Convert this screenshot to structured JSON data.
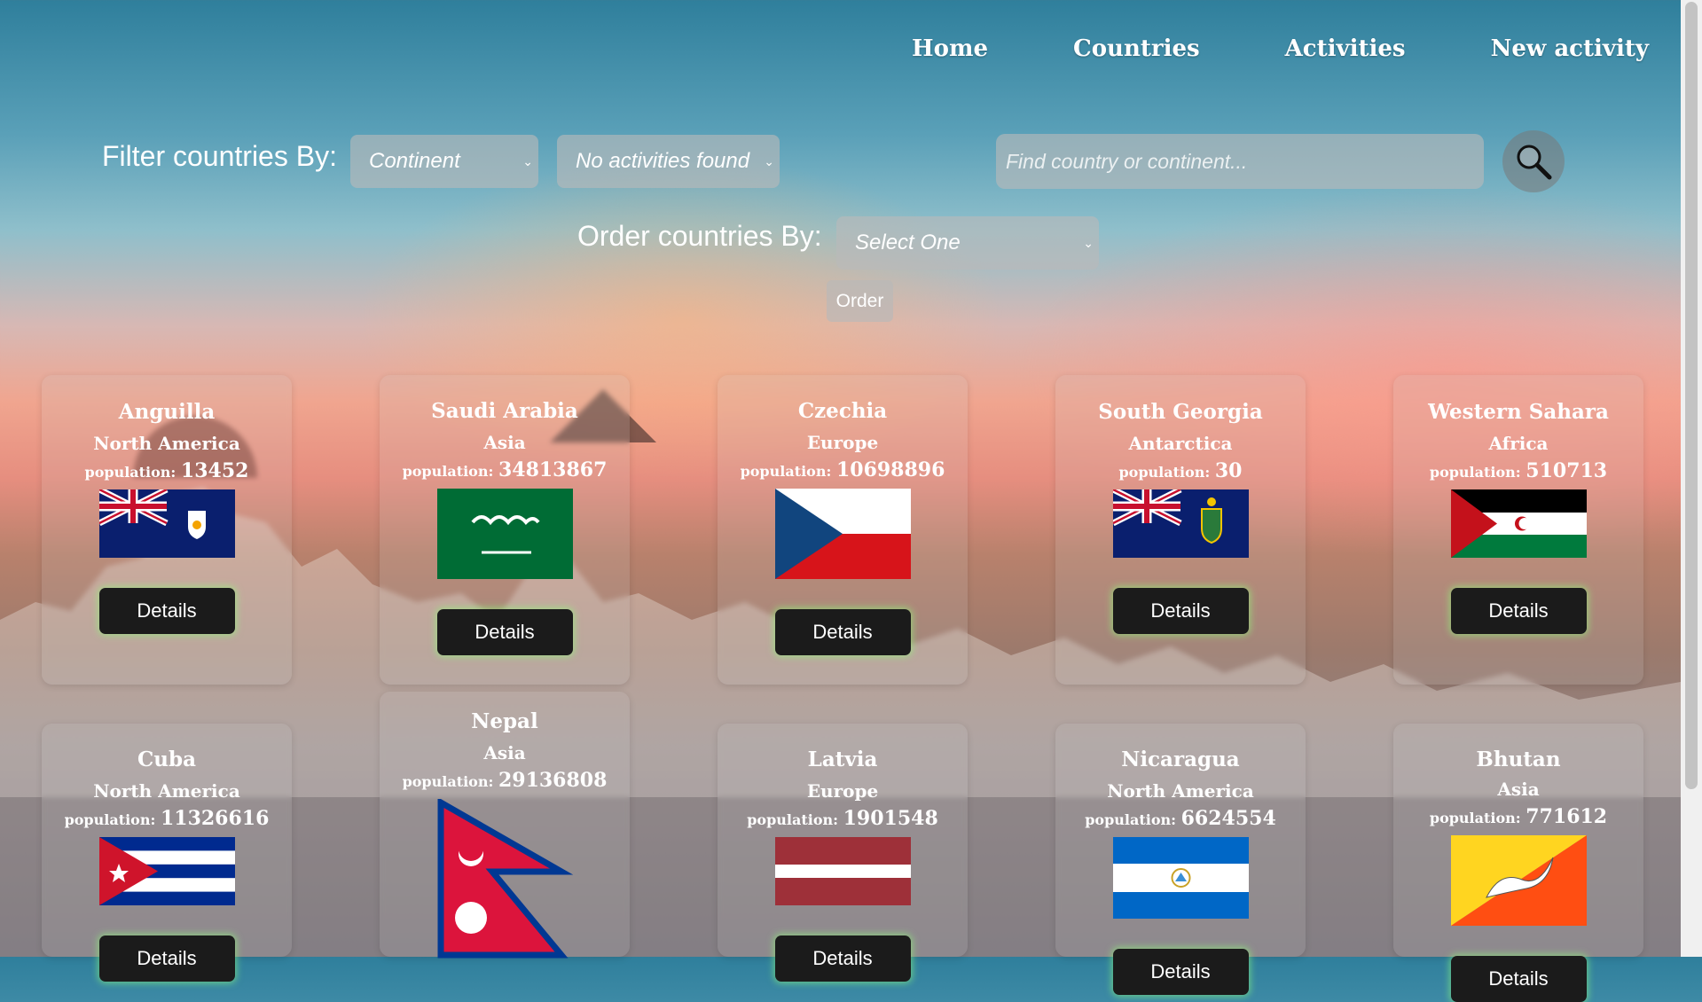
{
  "nav": {
    "home": "Home",
    "countries": "Countries",
    "activities": "Activities",
    "new_activity": "New activity"
  },
  "filter": {
    "label": "Filter countries By:",
    "continent_select": "Continent",
    "activities_select": "No activities found",
    "search_placeholder": "Find country or continent..."
  },
  "order": {
    "label": "Order countries By:",
    "select": "Select One",
    "button": "Order"
  },
  "population_label": "population:",
  "details_label": "Details",
  "cards": [
    {
      "name": "Anguilla",
      "continent": "North America",
      "population": "13452"
    },
    {
      "name": "Saudi Arabia",
      "continent": "Asia",
      "population": "34813867"
    },
    {
      "name": "Czechia",
      "continent": "Europe",
      "population": "10698896"
    },
    {
      "name": "South Georgia",
      "continent": "Antarctica",
      "population": "30"
    },
    {
      "name": "Western Sahara",
      "continent": "Africa",
      "population": "510713"
    },
    {
      "name": "Cuba",
      "continent": "North America",
      "population": "11326616"
    },
    {
      "name": "Nepal",
      "continent": "Asia",
      "population": "29136808"
    },
    {
      "name": "Latvia",
      "continent": "Europe",
      "population": "1901548"
    },
    {
      "name": "Nicaragua",
      "continent": "North America",
      "population": "6624554"
    },
    {
      "name": "Bhutan",
      "continent": "Asia",
      "population": "771612"
    }
  ],
  "colors": {
    "details_bg": "#1b1b1b",
    "details_glow": "#8cff78"
  }
}
